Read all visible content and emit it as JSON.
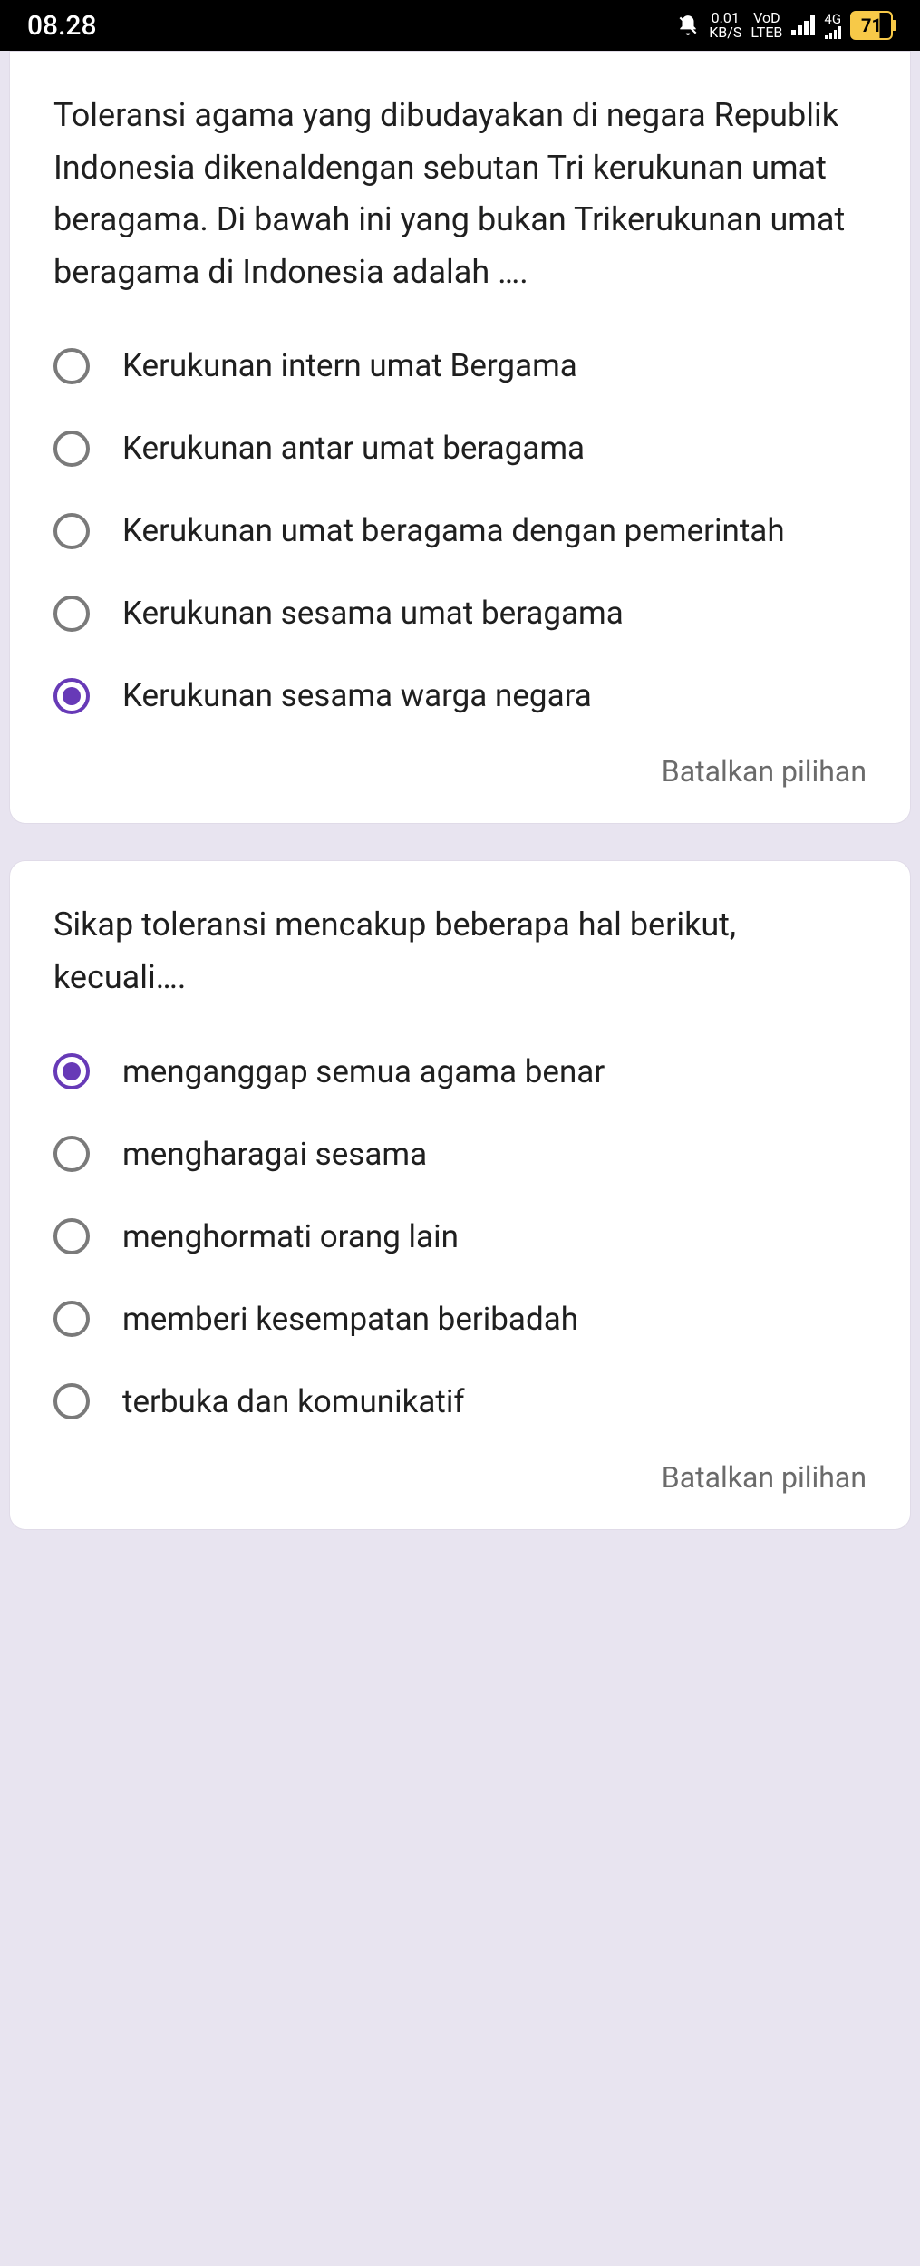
{
  "status_bar": {
    "time": "08.28",
    "data_speed_top": "0.01",
    "data_speed_bottom": "KB/S",
    "vod_top": "VoD",
    "vod_bottom": "LTEB",
    "network": "4G",
    "battery": "71"
  },
  "questions": [
    {
      "text": "Toleransi agama yang dibudayakan di negara Republik Indonesia dikenaldengan sebutan Tri kerukunan umat beragama. Di bawah ini yang bukan Trikerukunan umat beragama di Indonesia adalah ….",
      "options": [
        {
          "label": "Kerukunan intern umat Bergama",
          "selected": false
        },
        {
          "label": "Kerukunan antar umat beragama",
          "selected": false
        },
        {
          "label": "Kerukunan umat beragama dengan pemerintah",
          "selected": false
        },
        {
          "label": "Kerukunan sesama umat beragama",
          "selected": false
        },
        {
          "label": "Kerukunan sesama warga negara",
          "selected": true
        }
      ],
      "clear_label": "Batalkan pilihan"
    },
    {
      "text": "Sikap toleransi mencakup beberapa hal berikut, kecuali….",
      "options": [
        {
          "label": "menganggap semua agama benar",
          "selected": true
        },
        {
          "label": "mengharagai sesama",
          "selected": false
        },
        {
          "label": "menghormati orang lain",
          "selected": false
        },
        {
          "label": "memberi kesempatan beribadah",
          "selected": false
        },
        {
          "label": "terbuka dan komunikatif",
          "selected": false
        }
      ],
      "clear_label": "Batalkan pilihan"
    }
  ]
}
